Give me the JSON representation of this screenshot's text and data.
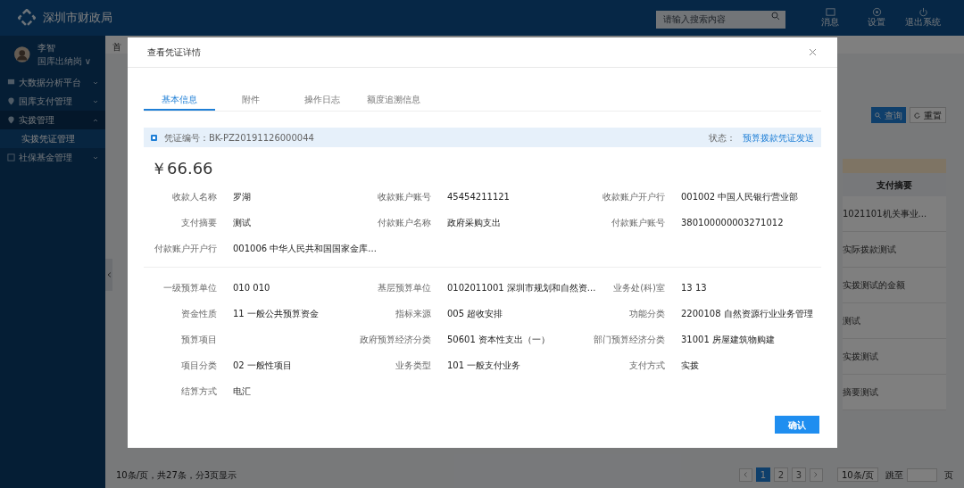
{
  "header": {
    "title": "深圳市财政局",
    "search": {
      "placeholder": "请输入搜索内容"
    },
    "actions": [
      {
        "label": "消息",
        "kind": "message"
      },
      {
        "label": "设置",
        "kind": "settings"
      },
      {
        "label": "退出系统",
        "kind": "logout"
      }
    ]
  },
  "user": {
    "name": "李智",
    "role": "国库出纳岗 ∨"
  },
  "sidebar": {
    "items": [
      {
        "label": "大数据分析平台",
        "kind": "chart",
        "expanded": false,
        "selected": false
      },
      {
        "label": "国库支付管理",
        "kind": "pin",
        "expanded": false,
        "selected": false
      },
      {
        "label": "实拨管理",
        "kind": "pin",
        "expanded": true,
        "selected": false,
        "children": [
          {
            "label": "实拨凭证管理",
            "selected": true
          }
        ]
      },
      {
        "label": "社保基金管理",
        "kind": "doc",
        "expanded": false,
        "selected": false
      }
    ]
  },
  "page_tab": "首",
  "toolbar": [
    {
      "label": "查询",
      "kind": "primary"
    },
    {
      "label": "重置",
      "kind": "default"
    }
  ],
  "table": {
    "column": "支付摘要",
    "rows": [
      "1021101机关事业...",
      "实际拨款测试",
      "实拨测试的金额",
      "测试",
      "实拨测试",
      "摘要测试"
    ]
  },
  "pagination": {
    "summary": "10条/页，共27条，分3页显示",
    "pages": [
      {
        "label": "1",
        "selected": true
      },
      {
        "label": "2",
        "selected": false
      },
      {
        "label": "3",
        "selected": false
      }
    ],
    "page_size": "10条/页",
    "jump_label": "跳至",
    "jump_suffix": "页"
  },
  "dialog": {
    "title": "查看凭证详情",
    "tabs": [
      {
        "label": "基本信息",
        "selected": true
      },
      {
        "label": "附件",
        "selected": false
      },
      {
        "label": "操作日志",
        "selected": false
      },
      {
        "label": "额度追溯信息",
        "selected": false
      }
    ],
    "voucher": "凭证编号：BK-PZ20191126000044",
    "status_label": "状态：",
    "status_value": "预算拨款凭证发送",
    "amount": "￥66.66",
    "sections": [
      [
        {
          "label": "收款人名称",
          "value": "罗湖"
        },
        {
          "label": "收款账户账号",
          "value": "45454211121"
        },
        {
          "label": "收款账户开户行",
          "value": "001002 中国人民银行营业部"
        },
        {
          "label": "支付摘要",
          "value": "测试"
        },
        {
          "label": "付款账户名称",
          "value": "政府采购支出"
        },
        {
          "label": "付款账户账号",
          "value": "380100000003271012"
        },
        {
          "label": "付款账户开户行",
          "value": "001006 中华人民共和国国家金库..."
        }
      ],
      [
        {
          "label": "一级预算单位",
          "value": "010 010"
        },
        {
          "label": "基层预算单位",
          "value": "0102011001 深圳市规划和自然资..."
        },
        {
          "label": "业务处(科)室",
          "value": "13 13"
        },
        {
          "label": "资金性质",
          "value": "11 一般公共预算资金"
        },
        {
          "label": "指标来源",
          "value": "005 超收安排"
        },
        {
          "label": "功能分类",
          "value": "2200108 自然资源行业业务管理"
        },
        {
          "label": "预算项目"
        },
        {
          "label": "政府预算经济分类",
          "value": "50601 资本性支出（一）"
        },
        {
          "label": "部门预算经济分类",
          "value": "31001 房屋建筑物购建"
        },
        {
          "label": "项目分类",
          "value": "02 一般性项目"
        },
        {
          "label": "业务类型",
          "value": "101 一般支付业务"
        },
        {
          "label": "支付方式",
          "value": "实拨"
        },
        {
          "label": "结算方式",
          "value": "电汇"
        }
      ]
    ],
    "confirm": "确认"
  }
}
